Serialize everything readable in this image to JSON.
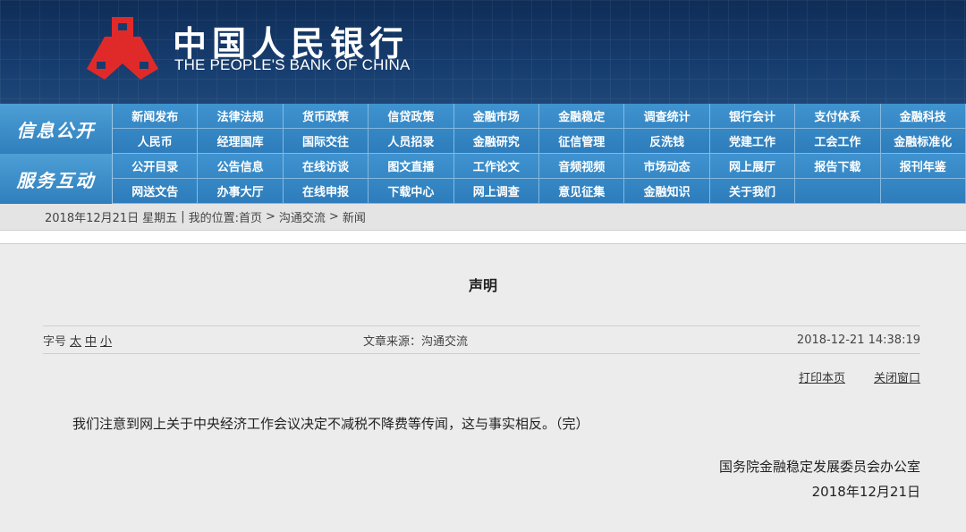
{
  "header": {
    "brand_cn": "中国人民银行",
    "brand_en": "THE PEOPLE'S BANK OF CHINA",
    "logo_icon": "pboc-logo-icon"
  },
  "nav": {
    "sections": [
      {
        "title": "信息公开",
        "rows": [
          [
            "新闻发布",
            "法律法规",
            "货币政策",
            "信贷政策",
            "金融市场",
            "金融稳定",
            "调查统计",
            "银行会计",
            "支付体系",
            "金融科技"
          ],
          [
            "人民币",
            "经理国库",
            "国际交往",
            "人员招录",
            "金融研究",
            "征信管理",
            "反洗钱",
            "党建工作",
            "工会工作",
            "金融标准化"
          ]
        ]
      },
      {
        "title": "服务互动",
        "rows": [
          [
            "公开目录",
            "公告信息",
            "在线访谈",
            "图文直播",
            "工作论文",
            "音频视频",
            "市场动态",
            "网上展厅",
            "报告下载",
            "报刊年鉴"
          ],
          [
            "网送文告",
            "办事大厅",
            "在线申报",
            "下载中心",
            "网上调查",
            "意见征集",
            "金融知识",
            "关于我们",
            "",
            ""
          ]
        ]
      }
    ]
  },
  "breadcrumb": {
    "date": "2018年12月21日",
    "weekday": "星期五",
    "sep": "|",
    "location_label": "我的位置:",
    "home": "首页",
    "arrow": ">",
    "section": "沟通交流",
    "current": "新闻"
  },
  "article": {
    "title": "声明",
    "font_size_label": "字号",
    "font_large": "太",
    "font_medium": "中",
    "font_small": "小",
    "source": "文章来源：沟通交流",
    "timestamp": "2018-12-21 14:38:19",
    "print": "打印本页",
    "close": "关闭窗口",
    "body": "我们注意到网上关于中央经济工作会议决定不减税不降费等传闻，这与事实相反。（完）",
    "signature": "国务院金融稳定发展委员会办公室",
    "date": "2018年12月21日"
  },
  "colors": {
    "header_bg": "#163c6e",
    "nav_bg": "#2d7cbb",
    "logo_red": "#e02a2a"
  }
}
